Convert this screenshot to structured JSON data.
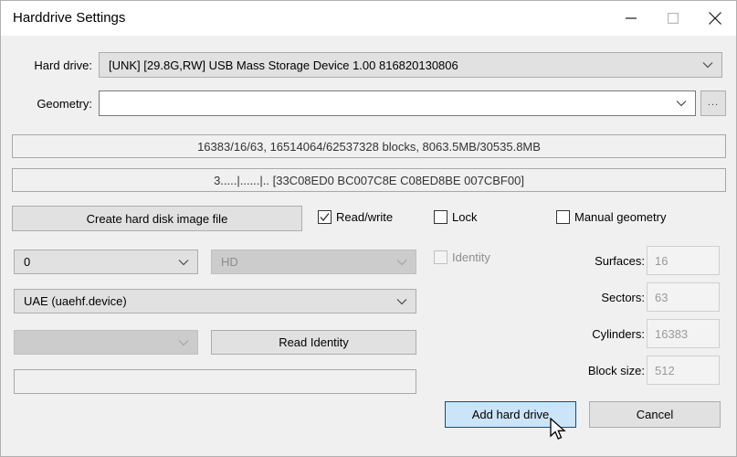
{
  "window": {
    "title": "Harddrive Settings",
    "controls": {
      "minimize": "minimize-icon",
      "maximize": "maximize-icon",
      "close": "close-icon"
    }
  },
  "form": {
    "harddrive_label": "Hard drive:",
    "harddrive_value": "[UNK] [29.8G,RW] USB Mass Storage Device 1.00 816820130806",
    "geometry_label": "Geometry:",
    "geometry_value": "",
    "browse_button": "...",
    "info_line_1": "16383/16/63, 16514064/62537328 blocks, 8063.5MB/30535.8MB",
    "info_line_2": "3.....|......|.. [33C08ED0 BC007C8E C08ED8BE 007CBF00]",
    "create_image_button": "Create hard disk image file",
    "readwrite_label": "Read/write",
    "readwrite_checked": true,
    "lock_label": "Lock",
    "lock_checked": false,
    "manual_geometry_label": "Manual geometry",
    "manual_geometry_checked": false,
    "identity_label": "Identity",
    "identity_checked": false,
    "unit_value": "0",
    "type_value": "HD",
    "controller_value": "UAE (uaehf.device)",
    "extra_combo_value": "",
    "read_identity_button": "Read Identity",
    "path_value": ""
  },
  "geometry": {
    "surfaces_label": "Surfaces:",
    "surfaces_value": "16",
    "sectors_label": "Sectors:",
    "sectors_value": "63",
    "cylinders_label": "Cylinders:",
    "cylinders_value": "16383",
    "blocksize_label": "Block size:",
    "blocksize_value": "512"
  },
  "actions": {
    "add_button": "Add hard drive",
    "cancel_button": "Cancel"
  },
  "colors": {
    "dialog_bg": "#f0f0f0",
    "titlebar_bg": "#ffffff",
    "accent_hover_bg": "#cce4f7",
    "accent_hover_border": "#005499",
    "disabled_text": "#8d8d8d"
  }
}
